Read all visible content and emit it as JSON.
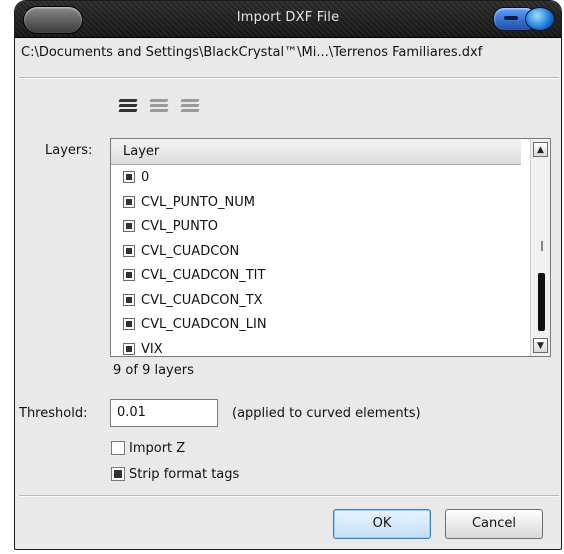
{
  "window": {
    "title": "Import DXF File"
  },
  "file_path": "C:\\Documents and Settings\\BlackCrystal™\\Mi...\\Terrenos Familiares.dxf",
  "layer_toolbar": {
    "icons": [
      "layers-select-all-icon",
      "layers-select-none-icon",
      "layers-invert-icon"
    ]
  },
  "layers": {
    "label": "Layers:",
    "column_header": "Layer",
    "items": [
      {
        "name": "0",
        "checked": true
      },
      {
        "name": "CVL_PUNTO_NUM",
        "checked": true
      },
      {
        "name": "CVL_PUNTO",
        "checked": true
      },
      {
        "name": "CVL_CUADCON",
        "checked": true
      },
      {
        "name": "CVL_CUADCON_TIT",
        "checked": true
      },
      {
        "name": "CVL_CUADCON_TX",
        "checked": true
      },
      {
        "name": "CVL_CUADCON_LIN",
        "checked": true
      },
      {
        "name": "VIX",
        "checked": true
      }
    ],
    "count_text": "9 of 9 layers"
  },
  "threshold": {
    "label": "Threshold:",
    "value": "0.01",
    "hint": "(applied to curved elements)"
  },
  "options": {
    "import_z": {
      "label": "Import Z",
      "checked": false
    },
    "strip_format_tags": {
      "label": "Strip format tags",
      "checked": true
    }
  },
  "buttons": {
    "ok": "OK",
    "cancel": "Cancel"
  }
}
